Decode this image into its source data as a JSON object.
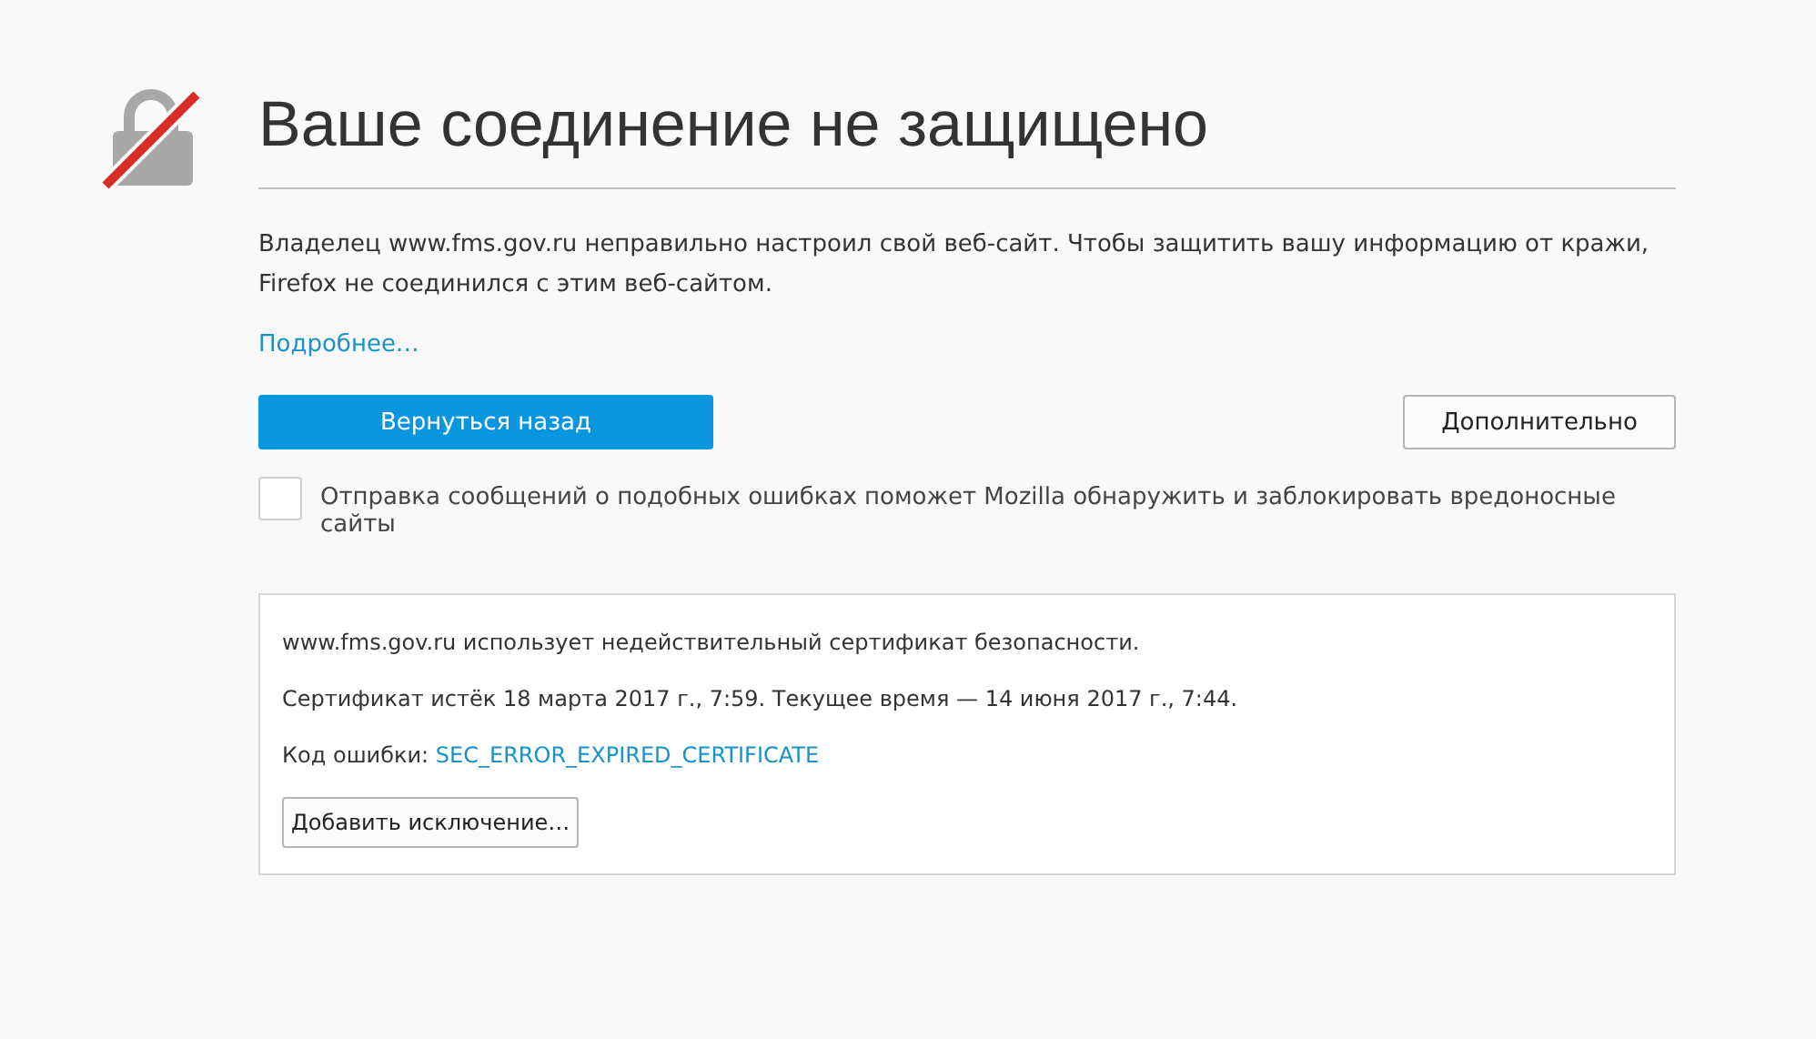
{
  "title": "Ваше соединение не защищено",
  "description": "Владелец www.fms.gov.ru неправильно настроил свой веб-сайт. Чтобы защитить вашу информацию от кражи, Firefox не соединился с этим веб-сайтом.",
  "learn_more": "Подробнее…",
  "buttons": {
    "primary": "Вернуться назад",
    "advanced": "Дополнительно"
  },
  "report": {
    "checked": false,
    "label": "Отправка сообщений о подобных ошибках поможет Mozilla обнаружить и заблокировать вредоносные сайты"
  },
  "advanced_panel": {
    "message": "www.fms.gov.ru использует недействительный сертификат безопасности.",
    "details": "Сертификат истёк 18 марта 2017 г., 7:59. Текущее время — 14 июня 2017 г., 7:44.",
    "error_label": "Код ошибки: ",
    "error_code": "SEC_ERROR_EXPIRED_CERTIFICATE",
    "exception_button": "Добавить исключение…"
  }
}
